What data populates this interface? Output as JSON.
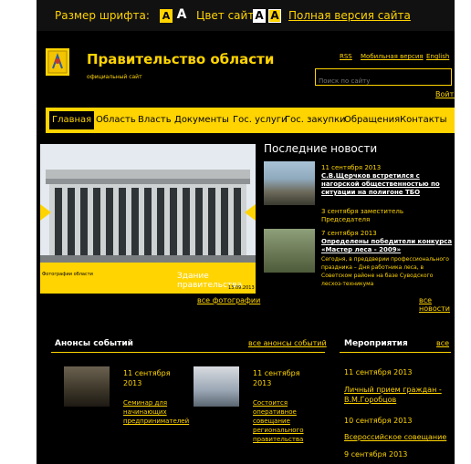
{
  "access": {
    "font_size_label": "Размер шрифта:",
    "font_small": "A",
    "font_large": "A",
    "color_label": "Цвет сайта:",
    "color_a": "A",
    "color_b": "A",
    "full_version": "Полная версия сайта"
  },
  "header": {
    "title": "Правительство области",
    "subtitle": "официальный сайт",
    "links": [
      "RSS",
      "Мобильная версия",
      "English"
    ],
    "search_placeholder": "Поиск по сайту",
    "login": "Войти"
  },
  "nav": {
    "items": [
      "Главная",
      "Область",
      "Власть",
      "Документы",
      "Гос. услуги",
      "Гос. закупки",
      "Обращения",
      "Контакты"
    ],
    "active_index": 0
  },
  "slider": {
    "left_caption": "Фотографии области",
    "caption": "Здание правительства",
    "date": "13.09.2013",
    "all_photos": "все фотографии"
  },
  "news": {
    "title": "Последние новости",
    "items": [
      {
        "date": "11 сентября 2013",
        "headline": "С.В.Щерчков встретился с нагорской общественностью по ситуации на полигоне ТБО"
      },
      {
        "date": "",
        "headline": "3 сентября заместитель Председателя"
      },
      {
        "date": "7 сентября 2013",
        "headline": "Определены победители конкурса «Мастер леса - 2009»",
        "text": "Сегодня, в преддверии профессионального праздника – Дня работника леса, в Советском районе на базе Суводского лесхоз-техникума"
      }
    ],
    "all_news": "все новости"
  },
  "announce": {
    "title": "Анонсы событий",
    "all_link": "все анонсы событий",
    "items": [
      {
        "date": "11 сентября 2013",
        "text": "Семинар для начинающих предпринимателей"
      },
      {
        "date": "11 сентября 2013",
        "text": "Состоится оперативное совещание регионального правительства"
      }
    ]
  },
  "events": {
    "title": "Мероприятия",
    "all_link": "все",
    "items": [
      {
        "date": "11 сентября 2013",
        "text": "Личный прием граждан - В.М.Горобцов"
      },
      {
        "date": "10 сентября 2013",
        "text": "Всероссийское совещание"
      },
      {
        "date": "9 сентября 2013",
        "text": ""
      }
    ]
  },
  "colors": {
    "accent": "#ffd400",
    "background": "#000000"
  }
}
